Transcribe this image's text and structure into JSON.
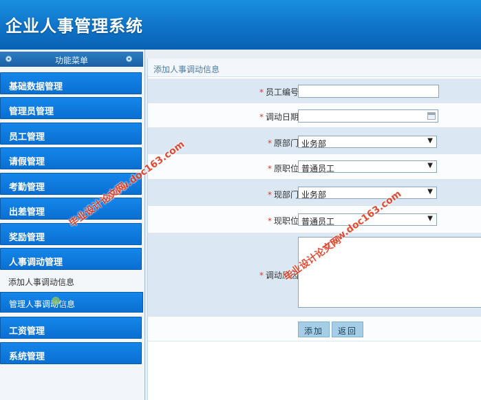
{
  "app": {
    "title": "企业人事管理系统"
  },
  "sidebar": {
    "header": "功能菜单",
    "items": [
      {
        "label": "基础数据管理"
      },
      {
        "label": "管理员管理"
      },
      {
        "label": "员工管理"
      },
      {
        "label": "请假管理"
      },
      {
        "label": "考勤管理"
      },
      {
        "label": "出差管理"
      },
      {
        "label": "奖励管理"
      },
      {
        "label": "人事调动管理"
      },
      {
        "label": "工资管理"
      },
      {
        "label": "系统管理"
      }
    ],
    "subitems": [
      {
        "label": "添加人事调动信息"
      },
      {
        "label": "管理人事调动信息"
      }
    ]
  },
  "panel": {
    "title": "添加人事调动信息"
  },
  "form": {
    "required_mark": "*",
    "employee_id": {
      "label": "员工编号:",
      "value": ""
    },
    "transfer_date": {
      "label": "调动日期:",
      "value": ""
    },
    "old_dept": {
      "label": "原部门:",
      "value": "业务部"
    },
    "old_position": {
      "label": "原职位:",
      "value": "普通员工"
    },
    "new_dept": {
      "label": "现部门:",
      "value": "业务部"
    },
    "new_position": {
      "label": "现职位:",
      "value": "普通员工"
    },
    "reason": {
      "label": "调动原因:",
      "value": ""
    }
  },
  "buttons": {
    "add": "添加",
    "back": "返回"
  },
  "watermarks": {
    "site": "www.doc163.com",
    "name": "毕业设计论文网"
  },
  "colors": {
    "accent": "#0a6fd2",
    "header": "#0f73c8",
    "required": "#d43a2a"
  }
}
